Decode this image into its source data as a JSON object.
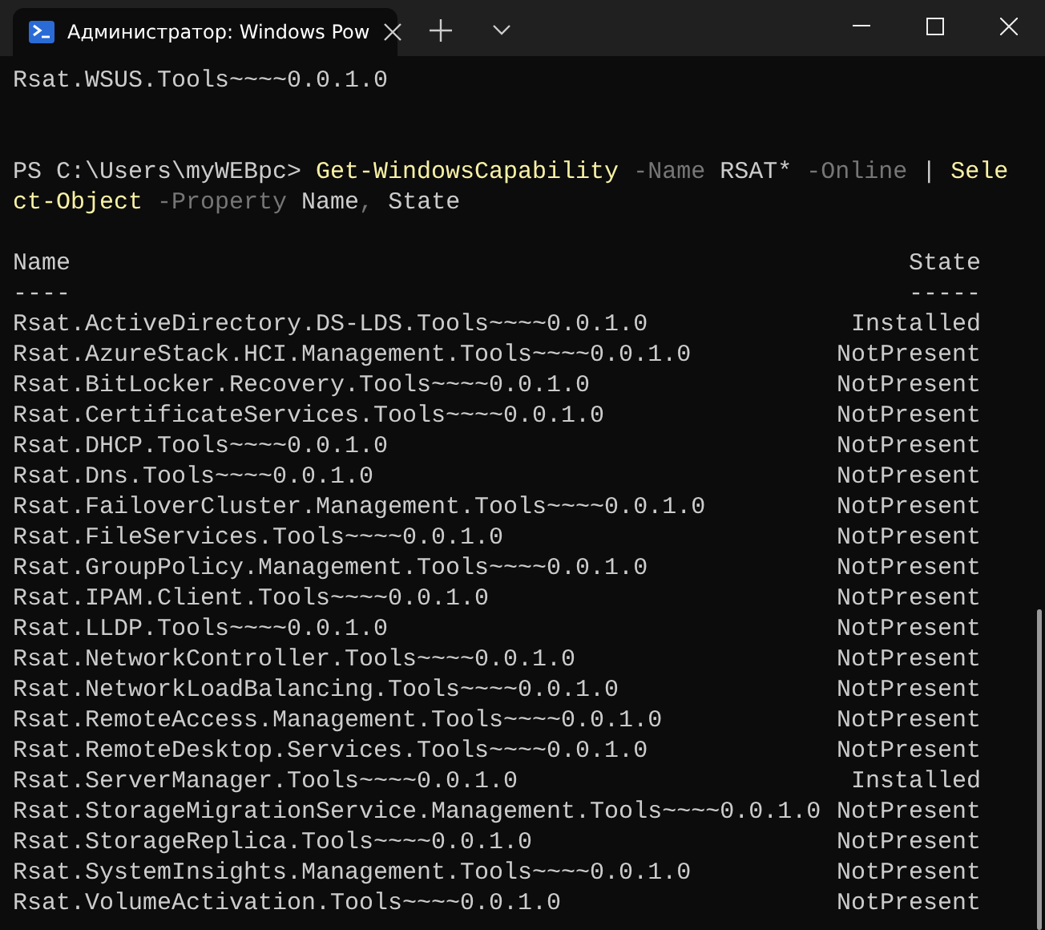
{
  "window": {
    "tab": {
      "title": "Администратор: Windows Pow",
      "selected": true
    }
  },
  "terminal": {
    "previous_line": "Rsat.WSUS.Tools~~~~0.0.1.0",
    "command": [
      {
        "kind": "prompt",
        "text": "PS C:\\Users\\myWEBpc> "
      },
      {
        "kind": "cmdlet",
        "text": "Get-WindowsCapability"
      },
      {
        "kind": "param",
        "text": " -Name"
      },
      {
        "kind": "plain",
        "text": " RSAT*"
      },
      {
        "kind": "param",
        "text": " -Online"
      },
      {
        "kind": "plain",
        "text": " | "
      },
      {
        "kind": "cmdlet",
        "text": "Select-Object"
      },
      {
        "kind": "param",
        "text": " -Property"
      },
      {
        "kind": "plain",
        "text": " Name"
      },
      {
        "kind": "param",
        "text": ","
      },
      {
        "kind": "plain",
        "text": " State"
      }
    ],
    "columns": [
      {
        "name": "Name",
        "rule": "----"
      },
      {
        "name": "State",
        "rule": "-----"
      }
    ],
    "rows": [
      {
        "name": "Rsat.ActiveDirectory.DS-LDS.Tools~~~~0.0.1.0",
        "state": "Installed"
      },
      {
        "name": "Rsat.AzureStack.HCI.Management.Tools~~~~0.0.1.0",
        "state": "NotPresent"
      },
      {
        "name": "Rsat.BitLocker.Recovery.Tools~~~~0.0.1.0",
        "state": "NotPresent"
      },
      {
        "name": "Rsat.CertificateServices.Tools~~~~0.0.1.0",
        "state": "NotPresent"
      },
      {
        "name": "Rsat.DHCP.Tools~~~~0.0.1.0",
        "state": "NotPresent"
      },
      {
        "name": "Rsat.Dns.Tools~~~~0.0.1.0",
        "state": "NotPresent"
      },
      {
        "name": "Rsat.FailoverCluster.Management.Tools~~~~0.0.1.0",
        "state": "NotPresent"
      },
      {
        "name": "Rsat.FileServices.Tools~~~~0.0.1.0",
        "state": "NotPresent"
      },
      {
        "name": "Rsat.GroupPolicy.Management.Tools~~~~0.0.1.0",
        "state": "NotPresent"
      },
      {
        "name": "Rsat.IPAM.Client.Tools~~~~0.0.1.0",
        "state": "NotPresent"
      },
      {
        "name": "Rsat.LLDP.Tools~~~~0.0.1.0",
        "state": "NotPresent"
      },
      {
        "name": "Rsat.NetworkController.Tools~~~~0.0.1.0",
        "state": "NotPresent"
      },
      {
        "name": "Rsat.NetworkLoadBalancing.Tools~~~~0.0.1.0",
        "state": "NotPresent"
      },
      {
        "name": "Rsat.RemoteAccess.Management.Tools~~~~0.0.1.0",
        "state": "NotPresent"
      },
      {
        "name": "Rsat.RemoteDesktop.Services.Tools~~~~0.0.1.0",
        "state": "NotPresent"
      },
      {
        "name": "Rsat.ServerManager.Tools~~~~0.0.1.0",
        "state": "Installed"
      },
      {
        "name": "Rsat.StorageMigrationService.Management.Tools~~~~0.0.1.0",
        "state": "NotPresent"
      },
      {
        "name": "Rsat.StorageReplica.Tools~~~~0.0.1.0",
        "state": "NotPresent"
      },
      {
        "name": "Rsat.SystemInsights.Management.Tools~~~~0.0.1.0",
        "state": "NotPresent"
      },
      {
        "name": "Rsat.VolumeActivation.Tools~~~~0.0.1.0",
        "state": "NotPresent"
      }
    ]
  }
}
